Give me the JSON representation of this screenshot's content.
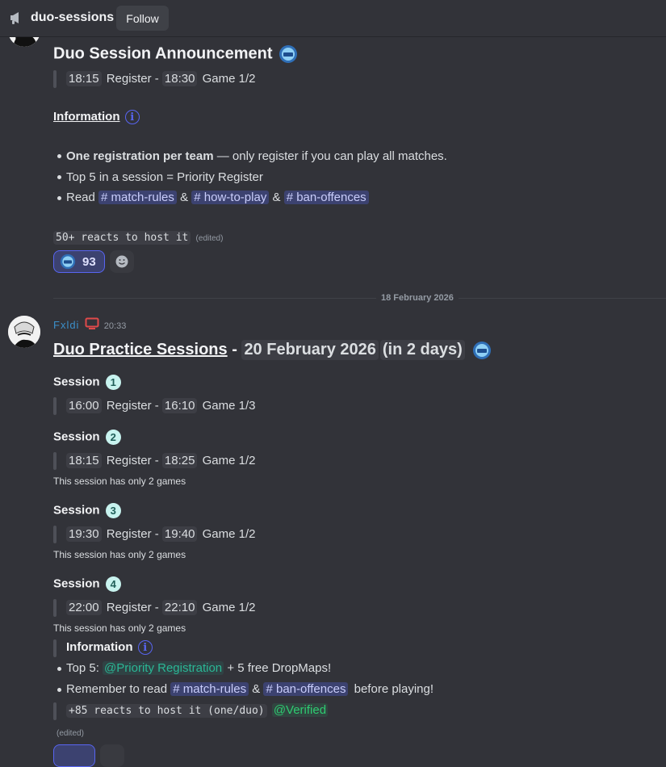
{
  "header": {
    "channel_name": "duo-sessions",
    "follow_label": "Follow",
    "icon": "megaphone-icon"
  },
  "msg1": {
    "title": "Duo Session Announcement",
    "line1": {
      "t1": "18:15",
      "mid": "Register -",
      "t2": "18:30",
      "end": "Game 1/2"
    },
    "info_heading": "Information",
    "bullets": [
      {
        "bold": "One registration per team",
        "rest": " — only register if you can play all matches."
      },
      {
        "text": "Top 5 in a session = Priority Register"
      }
    ],
    "read_prefix": "Read",
    "channels": [
      "match-rules",
      "how-to-play",
      "ban-offences"
    ],
    "amp": "&",
    "code_note": "50+ reacts to host it",
    "edited": "(edited)",
    "reaction_count": "93"
  },
  "date_divider": "18 February 2026",
  "msg2": {
    "author": "Fxldi",
    "time": "20:33",
    "title_link": "Duo Practice Sessions",
    "title_dash": " - ",
    "title_date": "20 February 2026",
    "title_rel": "(in 2 days)",
    "session_label": "Session",
    "register_word": "Register -",
    "sessions": [
      {
        "num": "1",
        "t1": "16:00",
        "t2": "16:10",
        "game": "Game 1/3",
        "note": ""
      },
      {
        "num": "2",
        "t1": "18:15",
        "t2": "18:25",
        "game": "Game 1/2",
        "note": "This session has only 2 games"
      },
      {
        "num": "3",
        "t1": "19:30",
        "t2": "19:40",
        "game": "Game 1/2",
        "note": "This session has only 2 games"
      },
      {
        "num": "4",
        "t1": "22:00",
        "t2": "22:10",
        "game": "Game 1/2",
        "note": "This session has only 2 games"
      }
    ],
    "info_heading": "Information",
    "top5_prefix": "Top 5:",
    "priority_role": "@Priority Registration",
    "top5_suffix": "+ 5 free DropMaps!",
    "remember_prefix": "Remember to read",
    "remember_suffix": "before playing!",
    "channels": [
      "match-rules",
      "ban-offences"
    ],
    "amp": "&",
    "code_note": "+85 reacts to host it (one/duo)",
    "verified_role": "@Verified",
    "edited": "(edited)"
  },
  "colors": {
    "background": "#323339",
    "mention_bg": "#3c4270",
    "author": "#3b8fc9",
    "badge_red": "#e04a4a"
  }
}
